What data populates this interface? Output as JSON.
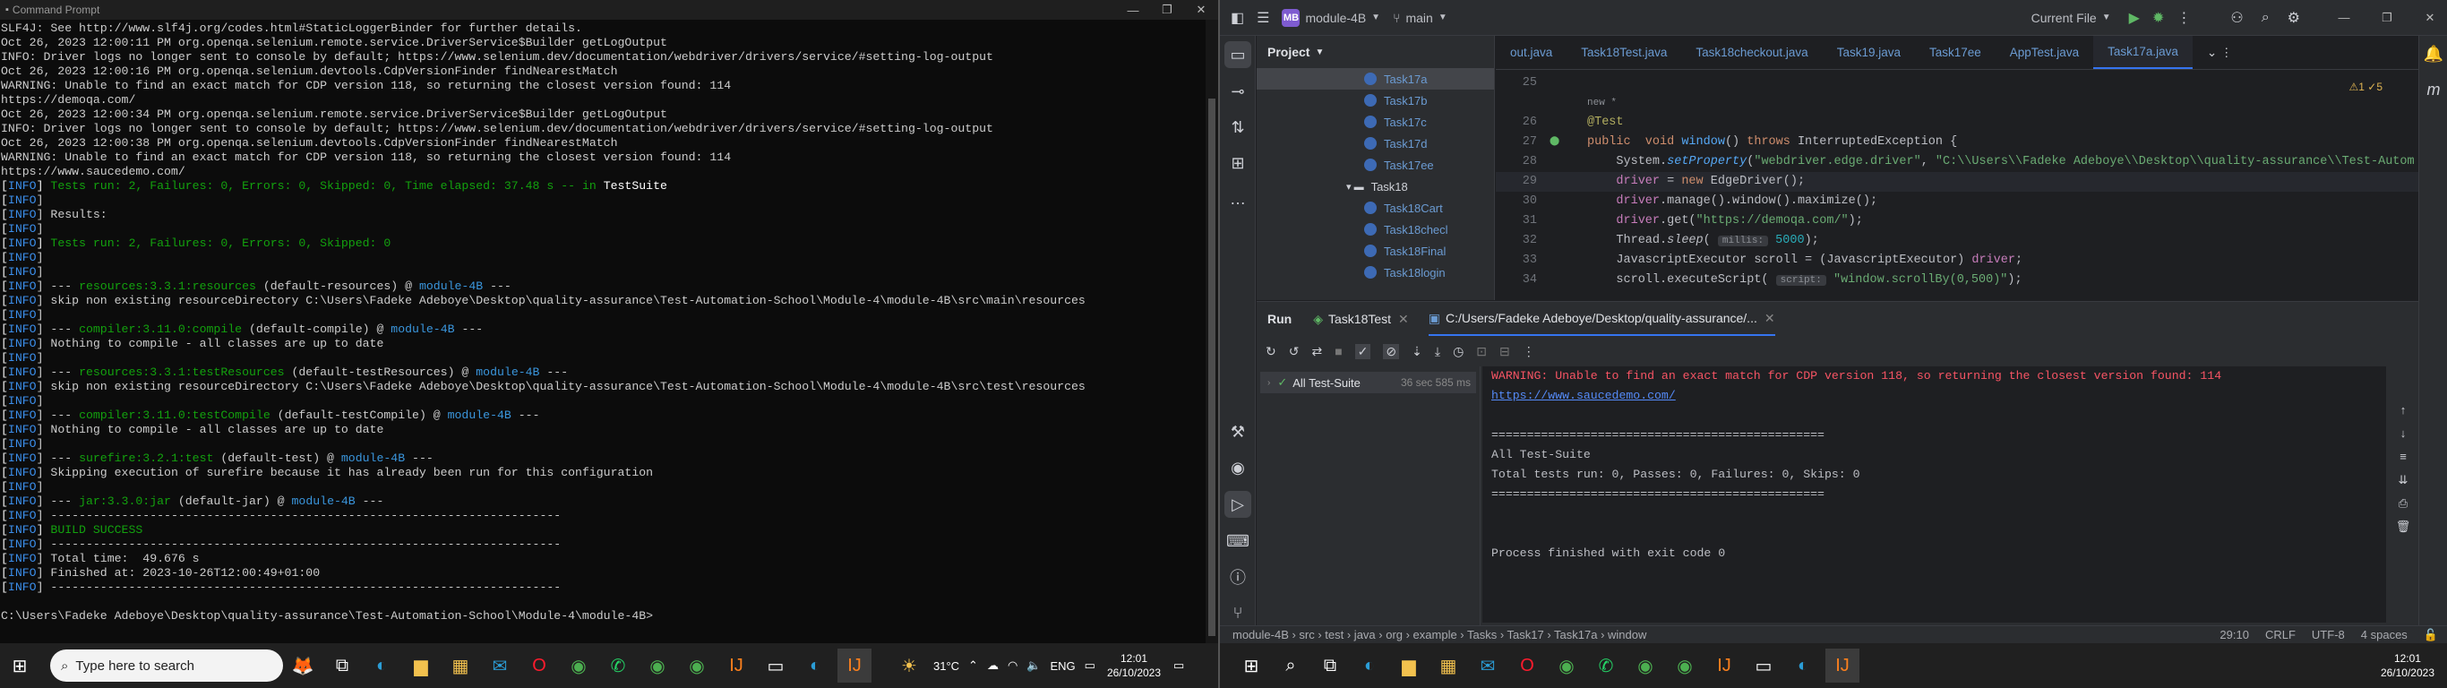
{
  "cmd": {
    "title": "Command Prompt",
    "window_buttons": [
      "—",
      "❐",
      "✕"
    ],
    "lines": [
      [
        [
          "SLF4J: See http://www.slf4j.org/codes.html#StaticLoggerBinder for further details.",
          ""
        ]
      ],
      [
        [
          "Oct 26, 2023 12:00:11 PM org.openqa.selenium.remote.service.DriverService$Builder getLogOutput",
          ""
        ]
      ],
      [
        [
          "INFO: Driver logs no longer sent to console by default; https://www.selenium.dev/documentation/webdriver/drivers/service/#setting-log-output",
          ""
        ]
      ],
      [
        [
          "Oct 26, 2023 12:00:16 PM org.openqa.selenium.devtools.CdpVersionFinder findNearestMatch",
          ""
        ]
      ],
      [
        [
          "WARNING: Unable to find an exact match for CDP version 118, so returning the closest version found: 114",
          ""
        ]
      ],
      [
        [
          "https://demoqa.com/",
          ""
        ]
      ],
      [
        [
          "Oct 26, 2023 12:00:34 PM org.openqa.selenium.remote.service.DriverService$Builder getLogOutput",
          ""
        ]
      ],
      [
        [
          "INFO: Driver logs no longer sent to console by default; https://www.selenium.dev/documentation/webdriver/drivers/service/#setting-log-output",
          ""
        ]
      ],
      [
        [
          "Oct 26, 2023 12:00:38 PM org.openqa.selenium.devtools.CdpVersionFinder findNearestMatch",
          ""
        ]
      ],
      [
        [
          "WARNING: Unable to find an exact match for CDP version 118, so returning the closest version found: 114",
          ""
        ]
      ],
      [
        [
          "https://www.saucedemo.com/",
          ""
        ]
      ],
      [
        [
          "[",
          "c-white"
        ],
        [
          "INFO",
          "c-info"
        ],
        [
          "] ",
          "c-white"
        ],
        [
          "Tests run: 2, Failures: 0, Errors: 0, Skipped: 0, Time elapsed: 37.48 s -- in ",
          "c-green"
        ],
        [
          "TestSuite",
          "c-bold"
        ]
      ],
      [
        [
          "[",
          "c-white"
        ],
        [
          "INFO",
          "c-info"
        ],
        [
          "] ",
          ""
        ]
      ],
      [
        [
          "[",
          "c-white"
        ],
        [
          "INFO",
          "c-info"
        ],
        [
          "] Results:",
          ""
        ]
      ],
      [
        [
          "[",
          "c-white"
        ],
        [
          "INFO",
          "c-info"
        ],
        [
          "] ",
          ""
        ]
      ],
      [
        [
          "[",
          "c-white"
        ],
        [
          "INFO",
          "c-info"
        ],
        [
          "] ",
          "c-white"
        ],
        [
          "Tests run: 2, Failures: 0, Errors: 0, Skipped: 0",
          "c-green"
        ]
      ],
      [
        [
          "[",
          "c-white"
        ],
        [
          "INFO",
          "c-info"
        ],
        [
          "] ",
          ""
        ]
      ],
      [
        [
          "[",
          "c-white"
        ],
        [
          "INFO",
          "c-info"
        ],
        [
          "] ",
          ""
        ]
      ],
      [
        [
          "[",
          "c-white"
        ],
        [
          "INFO",
          "c-info"
        ],
        [
          "] --- ",
          ""
        ],
        [
          "resources:3.3.1:resources",
          "c-green"
        ],
        [
          " (default-resources) @ ",
          ""
        ],
        [
          "module-4B",
          "c-cyan"
        ],
        [
          " ---",
          ""
        ]
      ],
      [
        [
          "[",
          "c-white"
        ],
        [
          "INFO",
          "c-info"
        ],
        [
          "] skip non existing resourceDirectory C:\\Users\\Fadeke Adeboye\\Desktop\\quality-assurance\\Test-Automation-School\\Module-4\\module-4B\\src\\main\\resources",
          ""
        ]
      ],
      [
        [
          "[",
          "c-white"
        ],
        [
          "INFO",
          "c-info"
        ],
        [
          "] ",
          ""
        ]
      ],
      [
        [
          "[",
          "c-white"
        ],
        [
          "INFO",
          "c-info"
        ],
        [
          "] --- ",
          ""
        ],
        [
          "compiler:3.11.0:compile",
          "c-green"
        ],
        [
          " (default-compile) @ ",
          ""
        ],
        [
          "module-4B",
          "c-cyan"
        ],
        [
          " ---",
          ""
        ]
      ],
      [
        [
          "[",
          "c-white"
        ],
        [
          "INFO",
          "c-info"
        ],
        [
          "] Nothing to compile - all classes are up to date",
          ""
        ]
      ],
      [
        [
          "[",
          "c-white"
        ],
        [
          "INFO",
          "c-info"
        ],
        [
          "] ",
          ""
        ]
      ],
      [
        [
          "[",
          "c-white"
        ],
        [
          "INFO",
          "c-info"
        ],
        [
          "] --- ",
          ""
        ],
        [
          "resources:3.3.1:testResources",
          "c-green"
        ],
        [
          " (default-testResources) @ ",
          ""
        ],
        [
          "module-4B",
          "c-cyan"
        ],
        [
          " ---",
          ""
        ]
      ],
      [
        [
          "[",
          "c-white"
        ],
        [
          "INFO",
          "c-info"
        ],
        [
          "] skip non existing resourceDirectory C:\\Users\\Fadeke Adeboye\\Desktop\\quality-assurance\\Test-Automation-School\\Module-4\\module-4B\\src\\test\\resources",
          ""
        ]
      ],
      [
        [
          "[",
          "c-white"
        ],
        [
          "INFO",
          "c-info"
        ],
        [
          "] ",
          ""
        ]
      ],
      [
        [
          "[",
          "c-white"
        ],
        [
          "INFO",
          "c-info"
        ],
        [
          "] --- ",
          ""
        ],
        [
          "compiler:3.11.0:testCompile",
          "c-green"
        ],
        [
          " (default-testCompile) @ ",
          ""
        ],
        [
          "module-4B",
          "c-cyan"
        ],
        [
          " ---",
          ""
        ]
      ],
      [
        [
          "[",
          "c-white"
        ],
        [
          "INFO",
          "c-info"
        ],
        [
          "] Nothing to compile - all classes are up to date",
          ""
        ]
      ],
      [
        [
          "[",
          "c-white"
        ],
        [
          "INFO",
          "c-info"
        ],
        [
          "] ",
          ""
        ]
      ],
      [
        [
          "[",
          "c-white"
        ],
        [
          "INFO",
          "c-info"
        ],
        [
          "] --- ",
          ""
        ],
        [
          "surefire:3.2.1:test",
          "c-green"
        ],
        [
          " (default-test) @ ",
          ""
        ],
        [
          "module-4B",
          "c-cyan"
        ],
        [
          " ---",
          ""
        ]
      ],
      [
        [
          "[",
          "c-white"
        ],
        [
          "INFO",
          "c-info"
        ],
        [
          "] Skipping execution of surefire because it has already been run for this configuration",
          ""
        ]
      ],
      [
        [
          "[",
          "c-white"
        ],
        [
          "INFO",
          "c-info"
        ],
        [
          "] ",
          ""
        ]
      ],
      [
        [
          "[",
          "c-white"
        ],
        [
          "INFO",
          "c-info"
        ],
        [
          "] --- ",
          ""
        ],
        [
          "jar:3.3.0:jar",
          "c-green"
        ],
        [
          " (default-jar) @ ",
          ""
        ],
        [
          "module-4B",
          "c-cyan"
        ],
        [
          " ---",
          ""
        ]
      ],
      [
        [
          "[",
          "c-white"
        ],
        [
          "INFO",
          "c-info"
        ],
        [
          "] ------------------------------------------------------------------------",
          ""
        ]
      ],
      [
        [
          "[",
          "c-white"
        ],
        [
          "INFO",
          "c-info"
        ],
        [
          "] ",
          "c-white"
        ],
        [
          "BUILD SUCCESS",
          "c-green"
        ]
      ],
      [
        [
          "[",
          "c-white"
        ],
        [
          "INFO",
          "c-info"
        ],
        [
          "] ------------------------------------------------------------------------",
          ""
        ]
      ],
      [
        [
          "[",
          "c-white"
        ],
        [
          "INFO",
          "c-info"
        ],
        [
          "] Total time:  49.676 s",
          ""
        ]
      ],
      [
        [
          "[",
          "c-white"
        ],
        [
          "INFO",
          "c-info"
        ],
        [
          "] Finished at: 2023-10-26T12:00:49+01:00",
          ""
        ]
      ],
      [
        [
          "[",
          "c-white"
        ],
        [
          "INFO",
          "c-info"
        ],
        [
          "] ------------------------------------------------------------------------",
          ""
        ]
      ],
      [
        [
          "",
          ""
        ]
      ],
      [
        [
          "C:\\Users\\Fadeke Adeboye\\Desktop\\quality-assurance\\Test-Automation-School\\Module-4\\module-4B>",
          ""
        ]
      ]
    ]
  },
  "ide": {
    "project_badge": "MB",
    "project_name": "module-4B",
    "branch": "main",
    "run_config": "Current File",
    "project_label": "Project",
    "tree": [
      {
        "label": "Task17a",
        "selected": true
      },
      {
        "label": "Task17b"
      },
      {
        "label": "Task17c"
      },
      {
        "label": "Task17d"
      },
      {
        "label": "Task17ee"
      },
      {
        "label": "Task18",
        "folder": true
      },
      {
        "label": "Task18Cart"
      },
      {
        "label": "Task18checl"
      },
      {
        "label": "Task18Final"
      },
      {
        "label": "Task18login"
      }
    ],
    "tabs": [
      "out.java",
      "Task18Test.java",
      "Task18checkout.java",
      "Task19.java",
      "Task17ee",
      "AppTest.java",
      "Task17a.java"
    ],
    "active_tab": "Task17a.java",
    "inspection": "⚠1 ✓5",
    "code_lines": [
      {
        "n": "25",
        "html": ""
      },
      {
        "n": "",
        "html": "<span style=\"color:#8c8f95;font-size:11px\">new *</span>"
      },
      {
        "n": "26",
        "html": "<span class=\"an\">@Test</span>"
      },
      {
        "n": "27",
        "html": "<span class=\"kw\">public  void</span> <span class=\"fn\">window</span>() <span class=\"kw\">throws</span> InterruptedException {"
      },
      {
        "n": "28",
        "html": "    System.<span class=\"fn\" style=\"font-style:italic\">setProperty</span>(<span class=\"st\">\"webdriver.edge.driver\"</span>, <span class=\"st\">\"C:\\\\Users\\\\Fadeke Adeboye\\\\Desktop\\\\quality-assurance\\\\Test-Autom</span>"
      },
      {
        "n": "29",
        "html": "    <span class=\"fld\">driver</span> = <span class=\"kw\">new</span> EdgeDriver();",
        "hl": true
      },
      {
        "n": "30",
        "html": "    <span class=\"fld\">driver</span>.manage().window().maximize();"
      },
      {
        "n": "31",
        "html": "    <span class=\"fld\">driver</span>.get(<span class=\"st\">\"https://demoqa.com/\"</span>);"
      },
      {
        "n": "32",
        "html": "    Thread.<span style=\"font-style:italic\">sleep</span>( <span class=\"hint\">millis:</span> <span style=\"color:#2aacb8\">5000</span>);"
      },
      {
        "n": "33",
        "html": "    JavascriptExecutor scroll = (JavascriptExecutor) <span class=\"fld\">driver</span>;"
      },
      {
        "n": "34",
        "html": "    scroll.executeScript( <span class=\"hint\">script:</span> <span class=\"st\">\"window.scrollBy(0,500)\"</span>);"
      }
    ],
    "run_label": "Run",
    "run_tab1": "Task18Test",
    "run_tab2": "C:/Users/Fadeke Adeboye/Desktop/quality-assurance/...",
    "suite_name": "All Test-Suite",
    "suite_time": "36 sec 585 ms",
    "console": [
      {
        "text": "WARNING: Unable to find an exact match for CDP version 118, so returning the closest version found: 114",
        "cls": "cwarn"
      },
      {
        "text": "https://www.saucedemo.com/",
        "cls": "clink"
      },
      {
        "text": "",
        "cls": ""
      },
      {
        "text": "===============================================",
        "cls": ""
      },
      {
        "text": "All Test-Suite",
        "cls": ""
      },
      {
        "text": "Total tests run: 0, Passes: 0, Failures: 0, Skips: 0",
        "cls": ""
      },
      {
        "text": "===============================================",
        "cls": ""
      },
      {
        "text": "",
        "cls": ""
      },
      {
        "text": "",
        "cls": ""
      },
      {
        "text": "Process finished with exit code 0",
        "cls": ""
      }
    ],
    "breadcrumb": "module-4B  ›  src  ›  test  ›  java  ›  org  ›  example  ›  Tasks  ›  Task17  ›  Task17a  ›  window",
    "status_pos": "29:10",
    "status_eol": "CRLF",
    "status_enc": "UTF-8",
    "status_indent": "4 spaces"
  },
  "taskbar": {
    "search_placeholder": "Type here to search",
    "weather": "31°C",
    "lang": "ENG",
    "time": "12:01",
    "date": "26/10/2023"
  }
}
